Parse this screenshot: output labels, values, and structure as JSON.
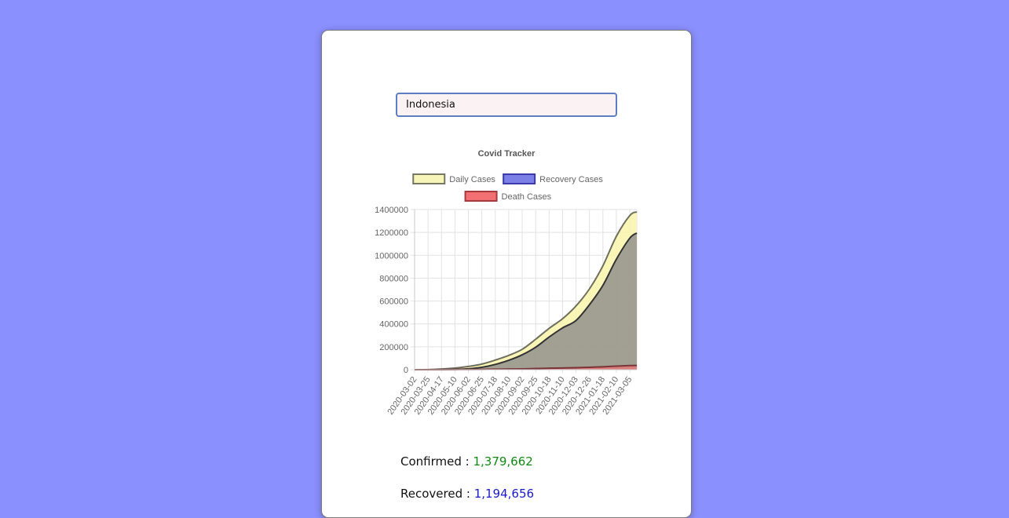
{
  "search": {
    "value": "Indonesia"
  },
  "chart_data": {
    "type": "area",
    "title": "Covid Tracker",
    "legend_position": "top",
    "grid": true,
    "ylim": [
      0,
      1400000
    ],
    "y_ticks": [
      "0",
      "200000",
      "400000",
      "600000",
      "800000",
      "1000000",
      "1200000",
      "1400000"
    ],
    "x_tick_labels": [
      "2020-03-02",
      "2020-03-25",
      "2020-04-17",
      "2020-05-10",
      "2020-06-02",
      "2020-06-25",
      "2020-07-18",
      "2020-08-10",
      "2020-09-02",
      "2020-09-25",
      "2020-10-18",
      "2020-11-10",
      "2020-12-03",
      "2020-12-26",
      "2021-01-18",
      "2021-02-10",
      "2021-03-05"
    ],
    "x": [
      "2020-03-02",
      "2020-03-25",
      "2020-04-17",
      "2020-05-10",
      "2020-06-02",
      "2020-06-25",
      "2020-07-18",
      "2020-08-10",
      "2020-09-02",
      "2020-09-25",
      "2020-10-18",
      "2020-11-10",
      "2020-12-03",
      "2020-12-26",
      "2021-01-18",
      "2021-02-10",
      "2021-03-05",
      "2021-03-17"
    ],
    "series": [
      {
        "name": "Daily Cases",
        "fill": "#f8f5b8",
        "stroke": "#777766",
        "values": [
          0,
          800,
          6000,
          14000,
          28000,
          49000,
          84000,
          125000,
          178000,
          266000,
          361000,
          445000,
          557000,
          706000,
          908000,
          1166000,
          1348000,
          1379662
        ]
      },
      {
        "name": "Recovery Cases",
        "fill": "#7b7fe6",
        "stroke": "#3b3ba8",
        "values": [
          0,
          100,
          1000,
          3000,
          8000,
          21000,
          46000,
          82000,
          130000,
          196000,
          285000,
          365000,
          430000,
          568000,
          737000,
          965000,
          1150000,
          1194656
        ]
      },
      {
        "name": "Death Cases",
        "fill": "#f26f72",
        "stroke": "#a33a3d",
        "values": [
          0,
          30,
          600,
          1100,
          1700,
          2800,
          4000,
          5600,
          7000,
          9900,
          12700,
          14800,
          17000,
          21000,
          25000,
          31000,
          36000,
          37266
        ]
      }
    ]
  },
  "stats": {
    "confirmed_label": "Confirmed : ",
    "confirmed_value": "1,379,662",
    "recovered_label": "Recovered : ",
    "recovered_value": "1,194,656"
  }
}
